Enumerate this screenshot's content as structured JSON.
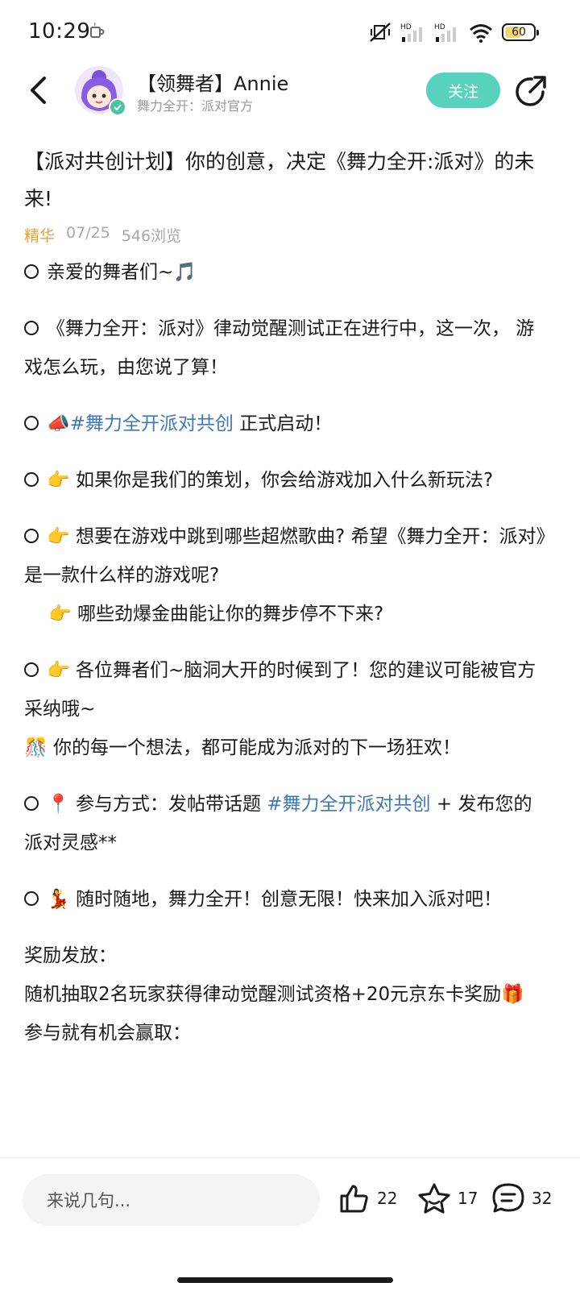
{
  "status_bar": {
    "time": "10:29",
    "net1": "HD",
    "net2": "HD",
    "battery": "60",
    "battery_level": 0.6
  },
  "header": {
    "author_name": "【领舞者】Annie",
    "author_subtitle": "舞力全开：派对官方",
    "follow_label": "关注"
  },
  "post": {
    "title": "【派对共创计划】你的创意，决定《舞力全开:派对》的未来!",
    "tag": "精华",
    "date": "07/25",
    "views": "546浏览",
    "p1": "亲爱的舞者们~🎵",
    "p2": "《舞力全开：派对》律动觉醒测试正在进行中，这一次， 游戏怎么玩，由您说了算！",
    "p3_prefix": "📣",
    "p3_hashtag": "#舞力全开派对共创",
    "p3_suffix": " 正式启动！",
    "p4": "👉 如果你是我们的策划，你会给游戏加入什么新玩法?",
    "p5": "👉 想要在游戏中跳到哪些超燃歌曲? 希望《舞力全开：派对》是一款什么样的游戏呢?",
    "p5b": "👉 哪些劲爆金曲能让你的舞步停不下来?",
    "p6": "👉 各位舞者们~脑洞大开的时候到了！您的建议可能被官方采纳哦~",
    "p6b": "🎊 你的每一个想法，都可能成为派对的下一场狂欢！",
    "p7_prefix": "📍 参与方式：发帖带话题 ",
    "p7_hashtag": "#舞力全开派对共创",
    "p7_suffix": "  + 发布您的派对灵感**",
    "p8": "💃 随时随地，舞力全开！创意无限！快来加入派对吧！",
    "reward_heading": "奖励发放：",
    "reward_text": "随机抽取2名玩家获得律动觉醒测试资格+20元京东卡奖励🎁",
    "reward_more": "参与就有机会赢取："
  },
  "bottom": {
    "comment_placeholder": "来说几句...",
    "likes": "22",
    "favorites": "17",
    "comments": "32"
  }
}
